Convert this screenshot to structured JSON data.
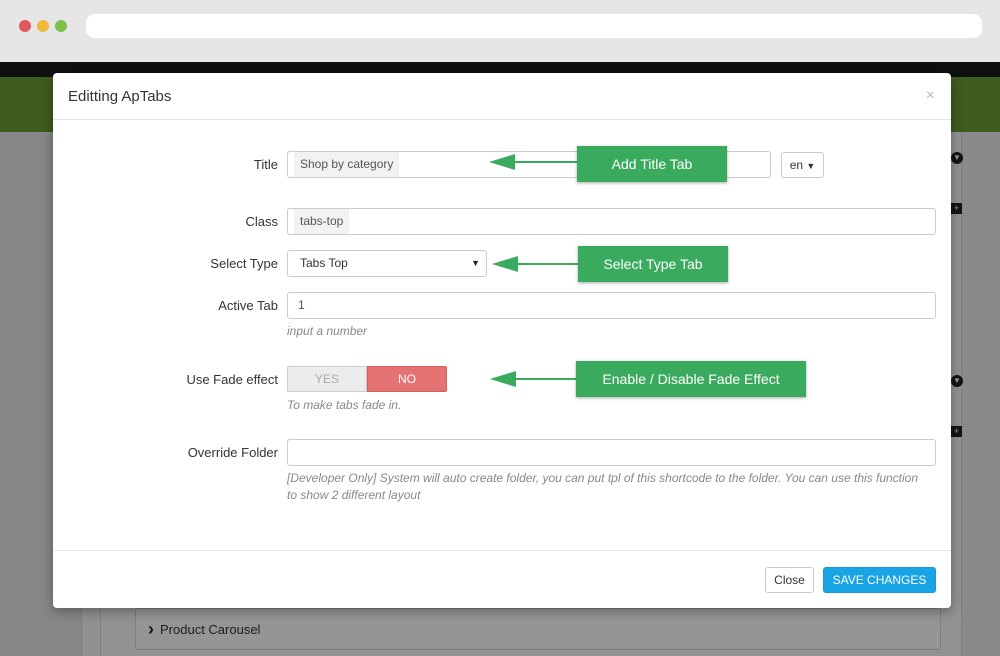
{
  "modal": {
    "title": "Editting ApTabs",
    "close_glyph": "×"
  },
  "form": {
    "title": {
      "label": "Title",
      "value": "Shop by category",
      "lang": "en"
    },
    "class": {
      "label": "Class",
      "value": "tabs-top"
    },
    "select_type": {
      "label": "Select Type",
      "value": "Tabs Top"
    },
    "active_tab": {
      "label": "Active Tab",
      "value": "1",
      "help": "input a number"
    },
    "fade": {
      "label": "Use Fade effect",
      "yes": "YES",
      "no": "NO",
      "selected": "NO",
      "help": "To make tabs fade in."
    },
    "override_folder": {
      "label": "Override Folder",
      "value": "",
      "help_line1": "[Developer Only] System will auto create folder, you can put tpl of this shortcode to the folder. You can use this function",
      "help_line2": "to show 2 different layout"
    }
  },
  "footer": {
    "close_label": "Close",
    "save_label": "SAVE CHANGES"
  },
  "callouts": {
    "title": "Add Title Tab",
    "select_type": "Select Type Tab",
    "fade": "Enable / Disable Fade Effect"
  },
  "background": {
    "product_carousel": "Product Carousel"
  },
  "colors": {
    "callout": "#3aaa5e",
    "save_button": "#19a4e6",
    "toggle_no": "#e57373",
    "header_green": "#6b9a34"
  },
  "icons": {
    "caret": "caret-down-icon",
    "chevron": "chevron-right-icon",
    "circle_down": "circle-down-icon",
    "square_plus": "square-plus-icon"
  }
}
